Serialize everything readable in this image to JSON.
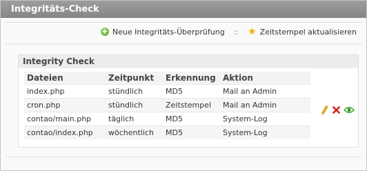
{
  "panel": {
    "title": "Integritäts-Check"
  },
  "toolbar": {
    "new_check_label": "Neue Integritäts-Überprüfung",
    "separator": "::",
    "timestamp_label": "Zeitstempel aktualisieren",
    "new_check_icon": "add-icon",
    "timestamp_icon": "star-icon"
  },
  "box": {
    "title": "Integrity Check",
    "columns": [
      "Dateien",
      "Zeitpunkt",
      "Erkennung",
      "Aktion"
    ],
    "rows": [
      [
        "index.php",
        "stündlich",
        "MD5",
        "Mail an Admin"
      ],
      [
        "cron.php",
        "stündlich",
        "Zeitstempel",
        "Mail an Admin"
      ],
      [
        "contao/main.php",
        "täglich",
        "MD5",
        "System-Log"
      ],
      [
        "contao/index.php",
        "wöchentlich",
        "MD5",
        "System-Log"
      ]
    ],
    "action_icons": [
      "edit-icon",
      "delete-icon",
      "view-icon"
    ]
  },
  "colors": {
    "titlebar": "#8f8f8f",
    "add_icon": "#5aa82a",
    "star_icon": "#f0b400",
    "delete_icon": "#d02020",
    "view_icon": "#3b9a2a"
  }
}
